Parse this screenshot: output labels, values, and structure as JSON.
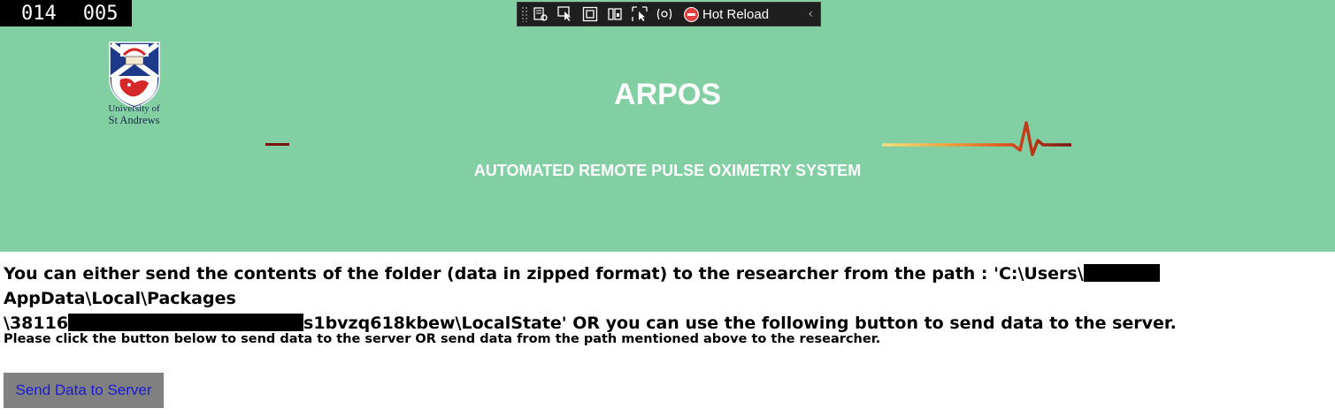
{
  "debug": {
    "counter_left": "014",
    "counter_right": "005"
  },
  "devtools": {
    "tools": [
      {
        "icon": "live-visual-tree-icon"
      },
      {
        "icon": "select-element-icon"
      },
      {
        "icon": "display-layout-adorners-icon"
      },
      {
        "icon": "track-focus-icon"
      },
      {
        "icon": "preview-selection-icon"
      },
      {
        "icon": "binding-failures-icon"
      }
    ],
    "hot_reload_label": "Hot Reload",
    "hot_reload_icon": "stop-circle-icon",
    "collapse_icon": "chevron-left-icon"
  },
  "header": {
    "background": "#82cfa4",
    "logo_line1": "University of",
    "logo_line2": "St Andrews",
    "title": "ARPOS",
    "subtitle": "AUTOMATED REMOTE PULSE OXIMETRY SYSTEM"
  },
  "content": {
    "message_part1": "You can either send the contents of the folder (data in zipped format) to the researcher from the path : 'C:\\Users\\",
    "message_part2": "AppData\\Local\\Packages",
    "message_part3": "\\38116",
    "message_part4": "s1bvzq618kbew\\LocalState'  OR you can use the following button to send data to the server.",
    "instruction": "Please click the button below to send data to the server OR send data from the path mentioned above to the researcher.",
    "send_button_label": "Send Data to Server"
  }
}
